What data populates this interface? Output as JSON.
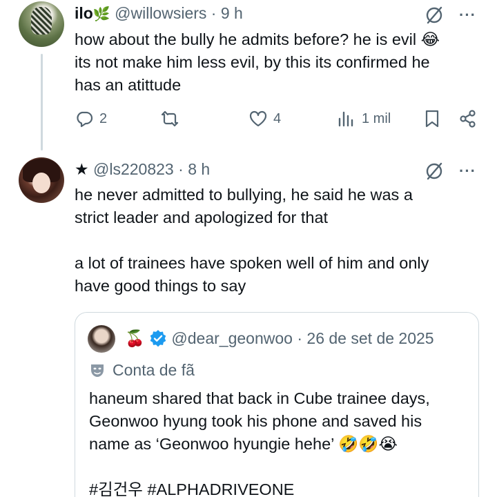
{
  "tweet1": {
    "display_name": "ilo",
    "name_badge": "🌿",
    "handle": "@willowsiers",
    "time": "9 h",
    "lines": [
      "how about the bully he admits before? he is evil 😂",
      "its not make him less evil, by this its confirmed he",
      "has an atittude"
    ],
    "replies": "2",
    "likes": "4",
    "views": "1 mil"
  },
  "tweet2": {
    "display_name": "★",
    "handle": "@ls220823",
    "time": "8 h",
    "paragraph1": [
      "he never admitted to bullying, he said he was a",
      "strict leader and apologized for that"
    ],
    "paragraph2": [
      "a lot of trainees have spoken well of him and only",
      "have good things to say"
    ]
  },
  "quote": {
    "name_emoji": "🍒",
    "handle": "@dear_geonwoo",
    "date": "26 de set de 2025",
    "account_label": "Conta de fã",
    "lines": [
      "haneum shared that back in Cube trainee days,",
      "Geonwoo hyung took his phone and saved his",
      "name as ‘Geonwoo hyungie hehe’ 🤣🤣😭"
    ],
    "hashtags": "#김건우 #ALPHADRIVEONE"
  },
  "icons": {
    "reply": "reply-icon",
    "retweet": "retweet-icon",
    "like": "heart-icon",
    "views": "views-icon",
    "bookmark": "bookmark-icon",
    "share": "share-icon",
    "grok": "slash-circle-icon",
    "more": "more-icon",
    "verified": "verified-icon",
    "fan_account": "mask-icon"
  },
  "colors": {
    "text": "#0f1419",
    "muted": "#536471",
    "border": "#cfd9de",
    "verified_blue": "#1d9bf0"
  }
}
